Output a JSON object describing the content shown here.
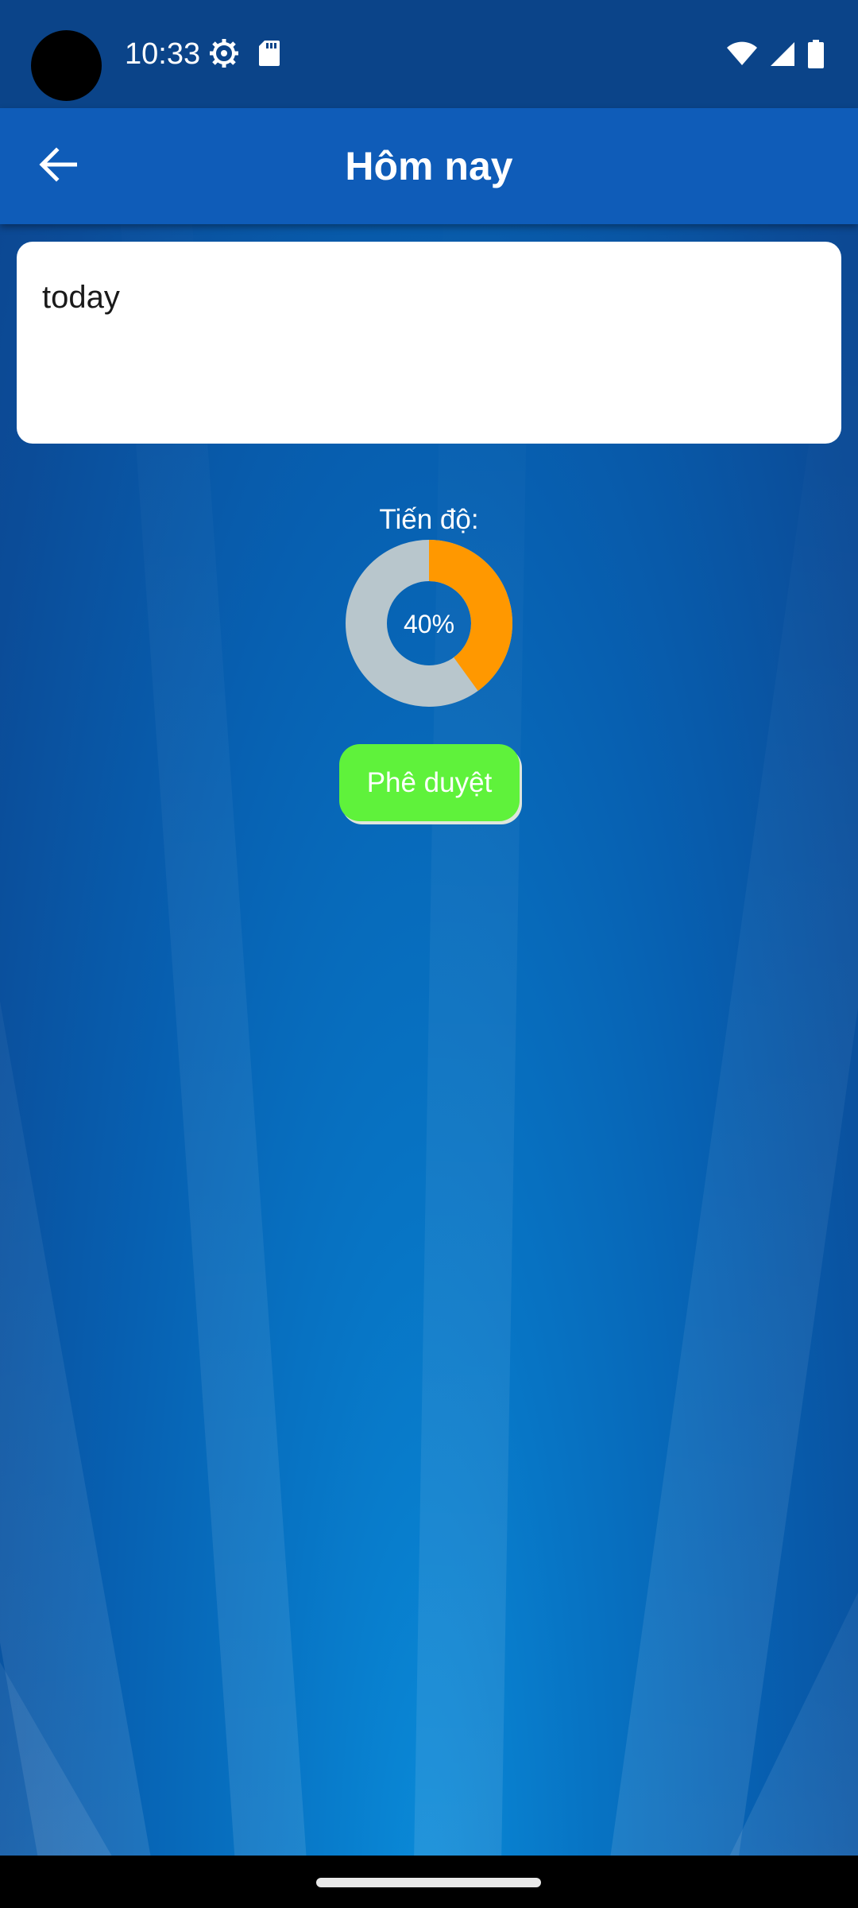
{
  "status_bar": {
    "time": "10:33",
    "icons_left": [
      "settings-gear-icon",
      "sd-card-icon"
    ],
    "icons_right": [
      "wifi-icon",
      "cellular-signal-icon",
      "battery-icon"
    ]
  },
  "app_bar": {
    "title": "Hôm nay",
    "back_icon": "arrow-back-icon"
  },
  "card": {
    "text": "today"
  },
  "progress": {
    "label": "Tiến độ:",
    "value_text": "40%",
    "value": 0.4,
    "done_color": "#ff9800",
    "remaining_color": "#b8c6cc"
  },
  "approve_button": {
    "label": "Phê duyệt",
    "color": "#5ff23b"
  },
  "colors": {
    "status_bar": "#0b4489",
    "app_bar": "#0f5cb8"
  }
}
